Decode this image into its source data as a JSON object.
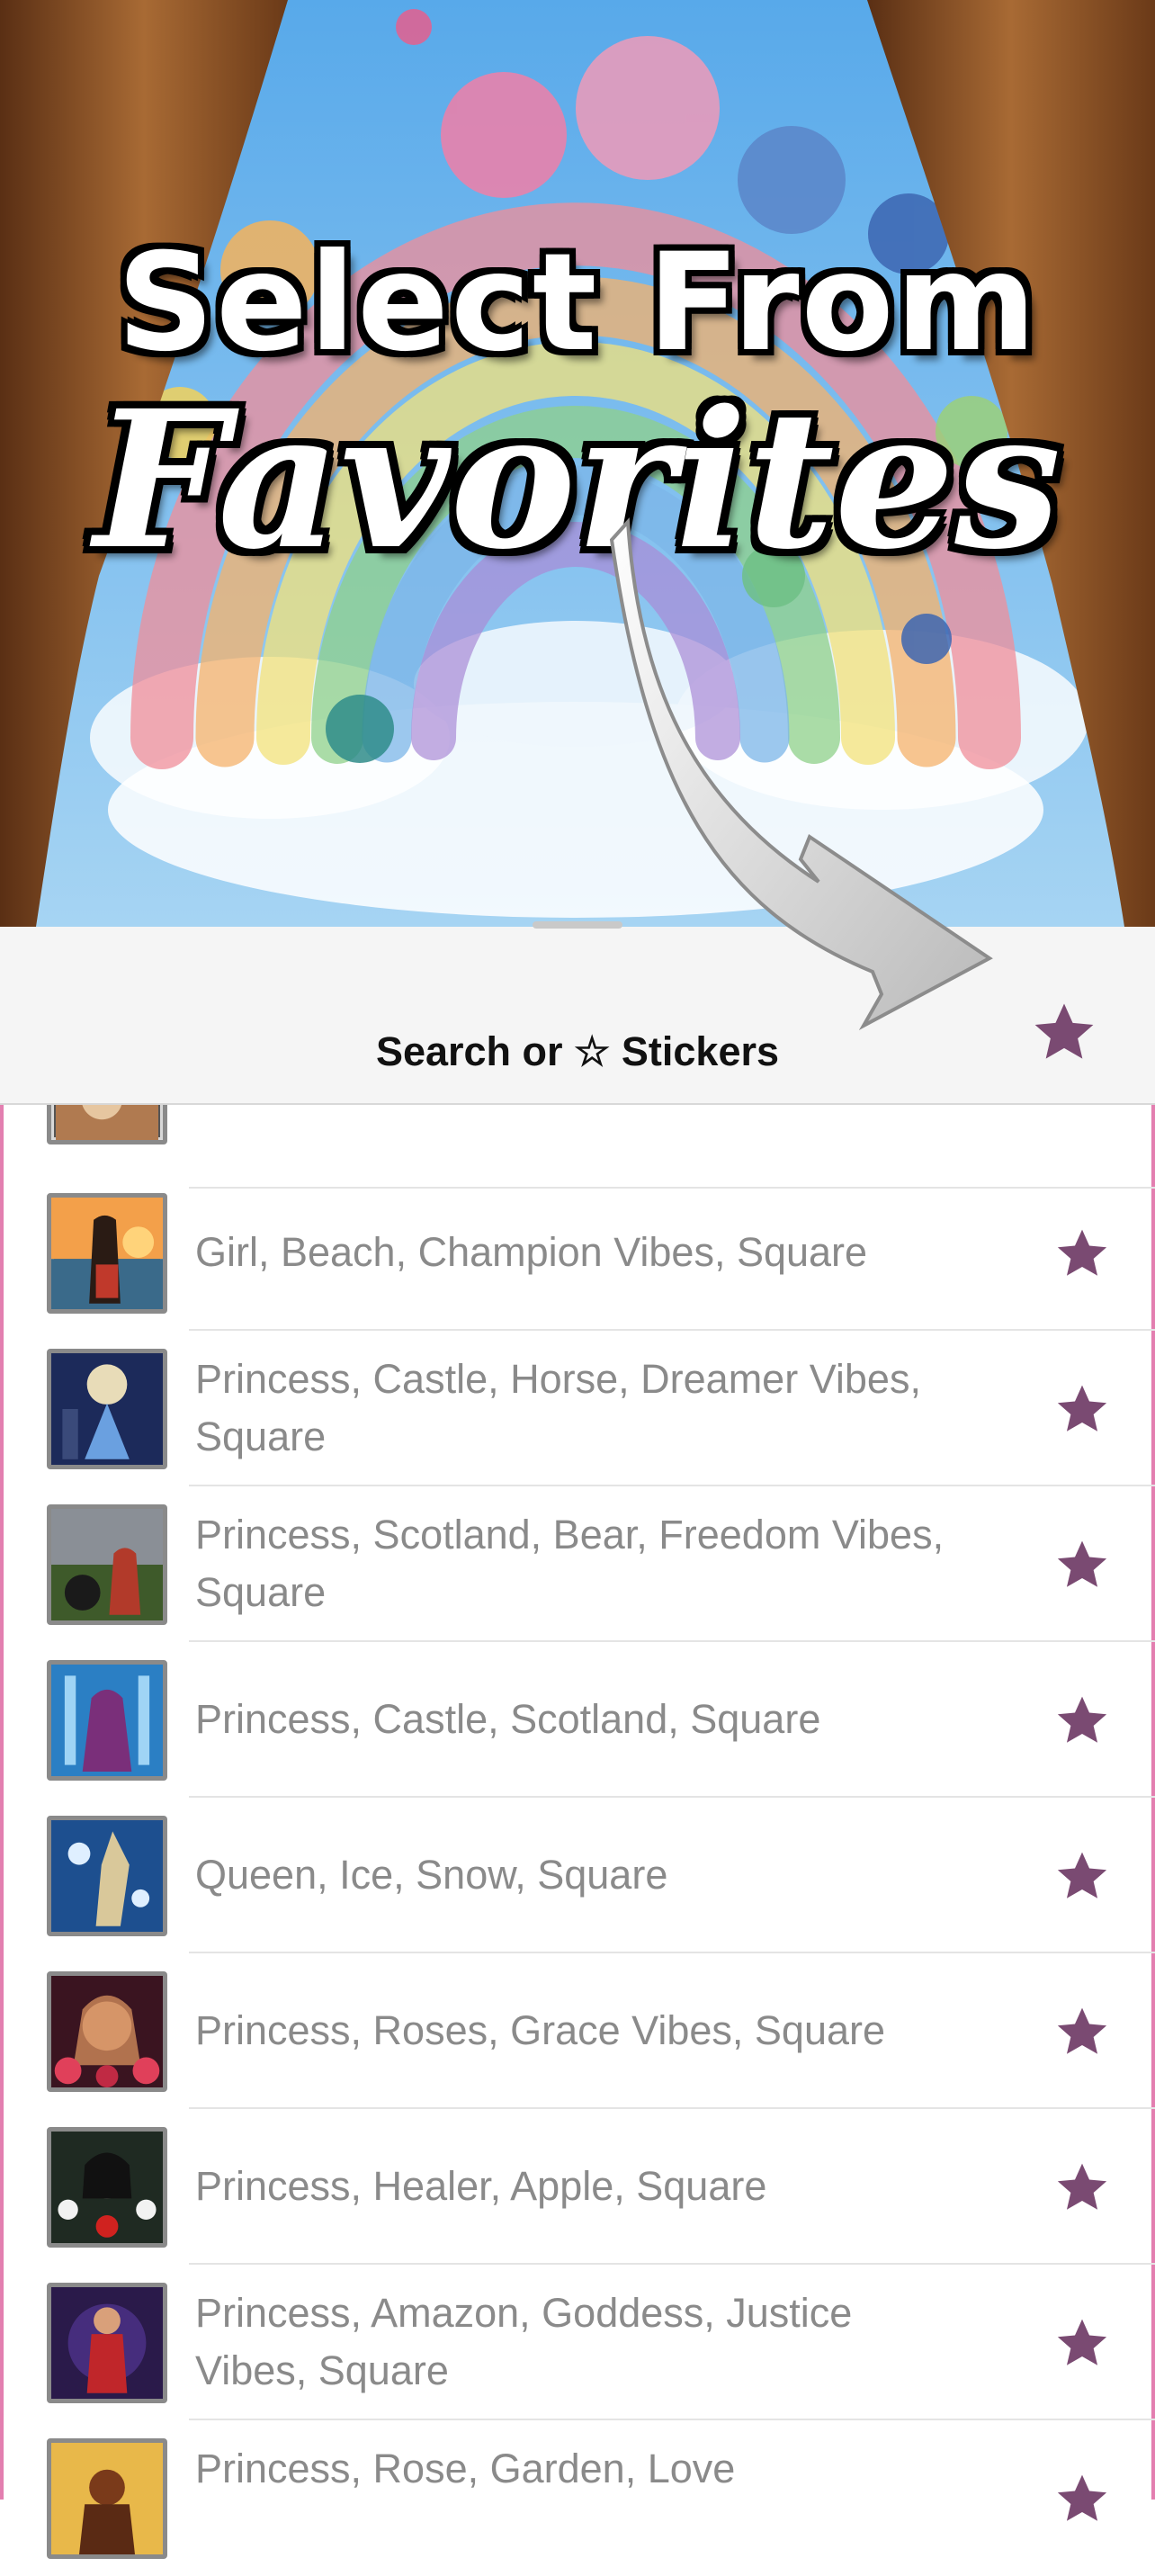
{
  "promo": {
    "title_line1": "Select From",
    "title_line2": "Favorites"
  },
  "header": {
    "title": "Search or ☆ Stickers",
    "favorites_icon": "star-filled-icon"
  },
  "colors": {
    "accent": "#7a4a72",
    "sheet_border": "#e37fb0",
    "label_text": "#8a8a8a"
  },
  "stickers": [
    {
      "label": "Girl, Beach, Champion Vibes, Square",
      "icon": "star-filled-icon"
    },
    {
      "label": "Princess, Castle, Horse, Dreamer Vibes, Square",
      "icon": "star-filled-icon"
    },
    {
      "label": "Princess, Scotland, Bear, Freedom Vibes, Square",
      "icon": "star-filled-icon"
    },
    {
      "label": "Princess, Castle, Scotland, Square",
      "icon": "star-filled-icon"
    },
    {
      "label": "Queen, Ice, Snow, Square",
      "icon": "star-filled-icon"
    },
    {
      "label": "Princess, Roses, Grace Vibes, Square",
      "icon": "star-filled-icon"
    },
    {
      "label": "Princess, Healer, Apple, Square",
      "icon": "star-filled-icon"
    },
    {
      "label": "Princess, Amazon, Goddess, Justice Vibes, Square",
      "icon": "star-filled-icon"
    },
    {
      "label": "Princess, Rose, Garden, Love",
      "icon": "star-filled-icon"
    }
  ]
}
